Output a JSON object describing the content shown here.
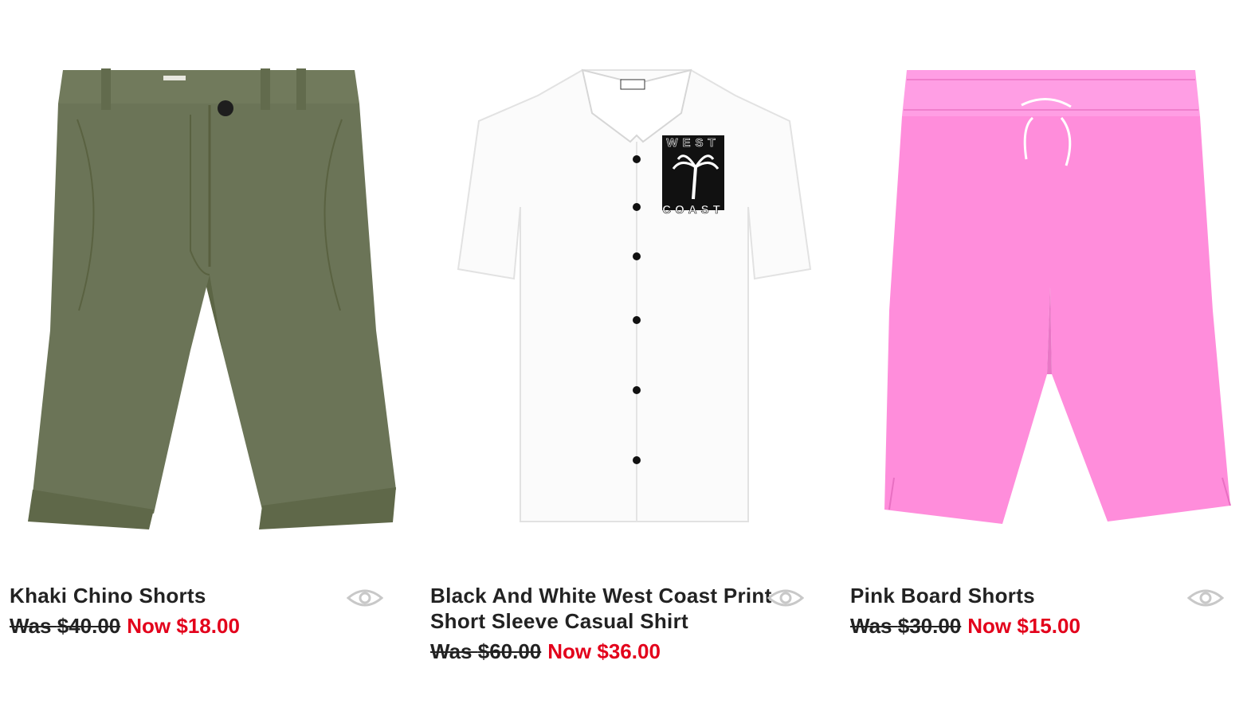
{
  "products": [
    {
      "name": "Khaki Chino Shorts",
      "was_label": "Was",
      "was_price": "$40.00",
      "now_label": "Now",
      "now_price": "$18.00",
      "image_icon": "khaki-chino-shorts-image",
      "color": "#6b7457"
    },
    {
      "name": "Black And White West Coast Print Short Sleeve Casual Shirt",
      "was_label": "Was",
      "was_price": "$60.00",
      "now_label": "Now",
      "now_price": "$36.00",
      "image_icon": "west-coast-shirt-image",
      "color": "#ffffff",
      "print_text_top": "WEST",
      "print_text_bottom": "COAST"
    },
    {
      "name": "Pink Board Shorts",
      "was_label": "Was",
      "was_price": "$30.00",
      "now_label": "Now",
      "now_price": "$15.00",
      "image_icon": "pink-board-shorts-image",
      "color": "#ff8fdc"
    }
  ],
  "quickview_icon": "eye-icon",
  "sale_color": "#e3001b"
}
